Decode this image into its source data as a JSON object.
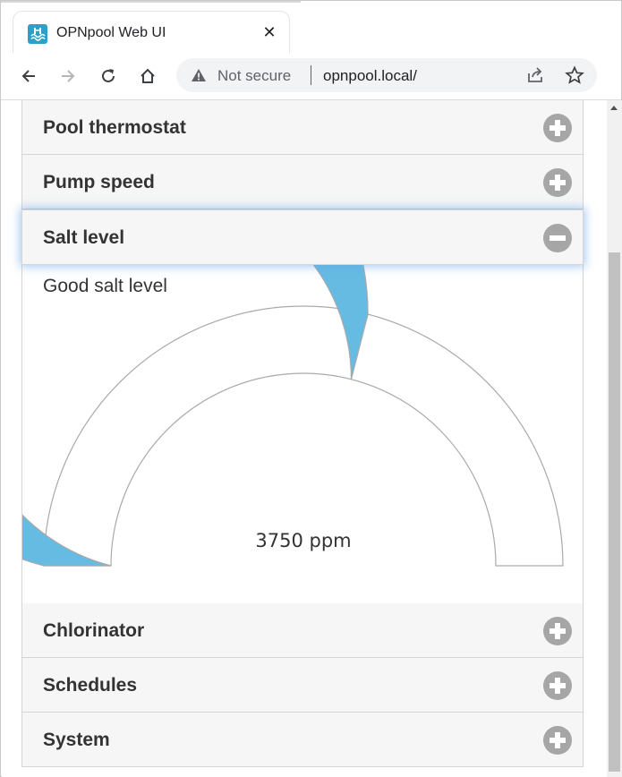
{
  "browser": {
    "tab_title": "OPNpool Web UI",
    "close_symbol": "✕",
    "security_label": "Not secure",
    "url": "opnpool.local/"
  },
  "accordion": {
    "sections": [
      {
        "title": "Pool thermostat",
        "state": "collapsed"
      },
      {
        "title": "Pump speed",
        "state": "collapsed"
      },
      {
        "title": "Salt level",
        "state": "expanded"
      },
      {
        "title": "Chlorinator",
        "state": "collapsed"
      },
      {
        "title": "Schedules",
        "state": "collapsed"
      },
      {
        "title": "System",
        "state": "collapsed"
      }
    ]
  },
  "salt": {
    "status": "Good salt level",
    "value_label": "3750 ppm",
    "gauge_fill_fraction": 0.58
  },
  "colors": {
    "gauge_fill": "#66bbe2",
    "accordion_icon": "#a6a6a6",
    "active_glow": "#64a0e6"
  },
  "icons": {
    "back": "arrow-left-icon",
    "forward": "arrow-right-icon",
    "reload": "reload-icon",
    "home": "home-icon",
    "warning": "warning-icon",
    "share": "share-icon",
    "bookmark": "star-icon",
    "expand": "plus-circle-icon",
    "collapse": "minus-circle-icon"
  }
}
